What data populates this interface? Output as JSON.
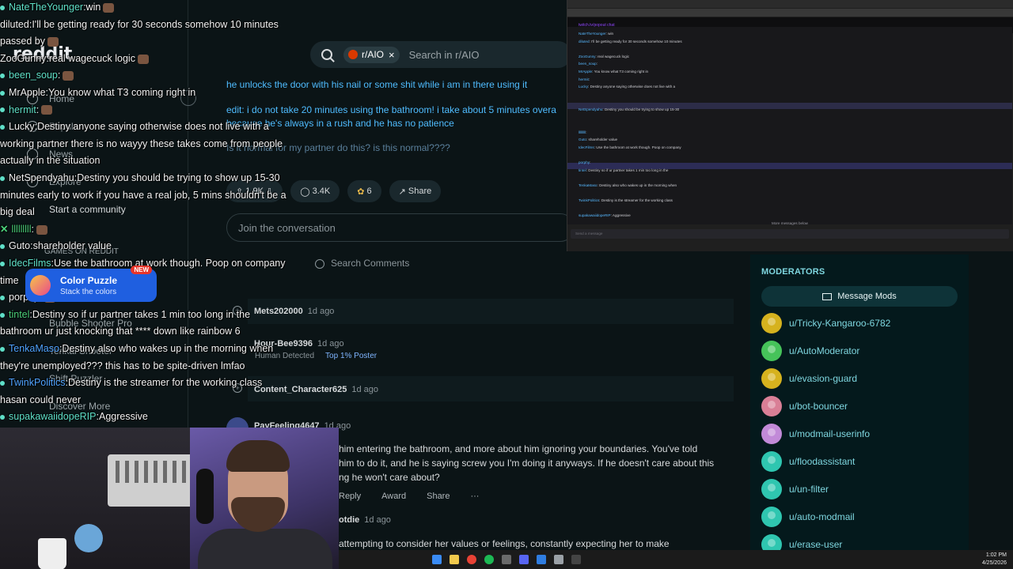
{
  "reddit": {
    "logo": "reddit",
    "nav": [
      "Home",
      "Popular",
      "News",
      "Explore",
      "Start a community",
      "GAMES ON REDDIT",
      "Bubble Shooter Pro",
      "Tenkai Shooter",
      "Shift Puzzler",
      "Discover More"
    ],
    "search": {
      "subreddit": "r/AIO",
      "placeholder": "Search in r/AIO"
    },
    "post_lines": [
      "he unlocks the door with his nail or some shit while i am in there using it",
      "edit: i do not take 20 minutes using the bathroom! i take about 5 minutes overa",
      "because he's always in a rush and he has no patience",
      "Is it normal for my partner do this? is this normal????"
    ],
    "actions": {
      "votes": "1.9K",
      "comments": "3.4K",
      "awards": "6",
      "share": "Share"
    },
    "join_placeholder": "Join the conversation",
    "search_comments": "Search Comments",
    "comments": [
      {
        "user": "Mets202000",
        "age": "1d ago"
      },
      {
        "user": "Hour-Bee9396",
        "age": "1d ago"
      },
      {
        "user": "Content_Character625",
        "age": "1d ago"
      },
      {
        "user": "PayFeeling4647",
        "age": "1d ago"
      },
      {
        "user": "otdie",
        "age": "1d ago"
      }
    ],
    "badges": {
      "human": "Human Detected",
      "poster": "Top 1% Poster"
    },
    "comment_body": [
      "him entering the bathroom, and more about him ignoring your boundaries. You've told",
      "him to do it, and he is saying screw you I'm doing it anyways. If he doesn't care about this",
      "ng he won't care about?"
    ],
    "comment_actions": {
      "reply": "Reply",
      "award": "Award",
      "share": "Share",
      "more": "···"
    },
    "comment_tail": "attempting to consider her values or feelings, constantly expecting her to make",
    "puzzle_ad": {
      "title": "Color Puzzle",
      "subtitle": "Stack the colors",
      "badge": "NEW"
    }
  },
  "moderators": {
    "title": "MODERATORS",
    "message_btn": "Message Mods",
    "list": [
      {
        "name": "u/Tricky-Kangaroo-6782",
        "color": "#d6b21e"
      },
      {
        "name": "u/AutoModerator",
        "color": "#46c35a"
      },
      {
        "name": "u/evasion-guard",
        "color": "#d6b21e"
      },
      {
        "name": "u/bot-bouncer",
        "color": "#d97f96"
      },
      {
        "name": "u/modmail-userinfo",
        "color": "#c28ad8"
      },
      {
        "name": "u/floodassistant",
        "color": "#2fc6b0"
      },
      {
        "name": "u/un-filter",
        "color": "#2fc6b0"
      },
      {
        "name": "u/auto-modmail",
        "color": "#2fc6b0"
      },
      {
        "name": "u/erase-user",
        "color": "#2fc6b0"
      }
    ]
  },
  "chat": [
    {
      "user": "NateTheYounger",
      "color": "#5fe0c8",
      "msg": "win",
      "dot": true
    },
    {
      "user": "diluted",
      "color": "#f2f2f2",
      "msg": "I'll be getting ready for 30 seconds somehow 10 minutes"
    },
    {
      "user": "",
      "color": "#f2f2f2",
      "msg": "passed by"
    },
    {
      "user": "ZooGunny",
      "color": "#f2f2f2",
      "msg": "real wagecuck logic"
    },
    {
      "user": "been_soup",
      "color": "#5fe0c8",
      "msg": "",
      "dot": true
    },
    {
      "user": "MrApple",
      "color": "#f2f2f2",
      "msg": "You know what T3 coming right in",
      "dot": true
    },
    {
      "user": "hermit",
      "color": "#5fe0c8",
      "msg": "",
      "dot": true
    },
    {
      "user": "Lucky",
      "color": "#f2f2f2",
      "msg": "Destiny anyone saying otherwise does not live with a",
      "dot": true
    },
    {
      "user": "",
      "color": "#f2f2f2",
      "msg": "working partner there is no wayyy these takes come from people"
    },
    {
      "user": "",
      "color": "#f2f2f2",
      "msg": "actually in the situation"
    },
    {
      "user": "NetSpendyahu",
      "color": "#f2f2f2",
      "msg": "Destiny you should be trying to show up 15-30",
      "dot": true
    },
    {
      "user": "",
      "color": "#f2f2f2",
      "msg": "minutes early to work if you have a real job, 5 mins shouldn't be a"
    },
    {
      "user": "",
      "color": "#f2f2f2",
      "msg": "big deal"
    },
    {
      "user": "lllllllll",
      "color": "#4bd07a",
      "msg": "",
      "x": true
    },
    {
      "user": "Guto",
      "color": "#f2f2f2",
      "msg": "shareholder value",
      "dot": true
    },
    {
      "user": "IdecFilms",
      "color": "#5fe0c8",
      "msg": "Use the bathroom at work though. Poop on company",
      "dot": true
    },
    {
      "user": "",
      "color": "#f2f2f2",
      "msg": "time"
    },
    {
      "user": "porphy",
      "color": "#f2f2f2",
      "msg": "",
      "dot": true
    },
    {
      "user": "tintel",
      "color": "#4bd07a",
      "msg": "Destiny so if ur partner takes 1 min too long in the",
      "dot": true
    },
    {
      "user": "",
      "color": "#f2f2f2",
      "msg": "bathroom ur just knocking that **** down like rainbow 6"
    },
    {
      "user": "TenkaMaso",
      "color": "#4fa3ff",
      "msg": "Destiny also who wakes up in the morning when",
      "dot": true
    },
    {
      "user": "",
      "color": "#f2f2f2",
      "msg": "they're unemployed??? this has to be spite-driven lmfao"
    },
    {
      "user": "TwinkPolitics",
      "color": "#4fa3ff",
      "msg": "Destiny is the streamer for the working class",
      "dot": true
    },
    {
      "user": "",
      "color": "#f2f2f2",
      "msg": "hasan could never"
    },
    {
      "user": "supakawaiidopeRIP",
      "color": "#5fe0c8",
      "msg": "Aggressive",
      "dot": true
    }
  ],
  "mini_window": {
    "url_line": "twitch.tv/popout chat",
    "more": "More messages below",
    "input": "Send a message"
  },
  "taskbar": {
    "time": "1:02 PM",
    "date": "4/25/2026"
  }
}
